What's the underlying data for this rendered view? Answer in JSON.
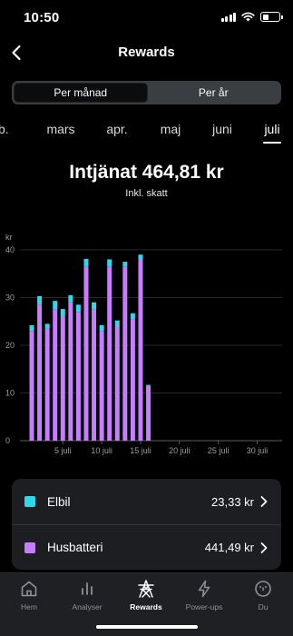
{
  "status_bar": {
    "time": "10:50"
  },
  "header": {
    "title": "Rewards"
  },
  "segment": {
    "month_label": "Per månad",
    "year_label": "Per år"
  },
  "months": {
    "items": [
      "feb.",
      "mars",
      "apr.",
      "maj",
      "juni",
      "juli"
    ],
    "active": "juli"
  },
  "summary": {
    "earned": "Intjänat 464,81 kr",
    "note": "Inkl. skatt"
  },
  "chart_data": {
    "type": "bar",
    "stacked": true,
    "ylabel": "kr",
    "ylim": [
      0,
      40
    ],
    "yticks": [
      0,
      10,
      20,
      30,
      40
    ],
    "x": [
      1,
      2,
      3,
      4,
      5,
      6,
      7,
      8,
      9,
      10,
      11,
      12,
      13,
      14,
      15,
      16,
      17,
      18,
      19,
      20,
      21,
      22,
      23,
      24,
      25,
      26,
      27,
      28,
      29,
      30,
      31
    ],
    "xticks": [
      5,
      10,
      15,
      20,
      25,
      30
    ],
    "xtick_labels": [
      "5 juli",
      "10 juli",
      "15 juli",
      "20 juli",
      "25 juli",
      "30 juli"
    ],
    "series": [
      {
        "name": "Husbatteri",
        "color": "#c77dff",
        "values": [
          23,
          28.5,
          23.5,
          27.5,
          26,
          29,
          27,
          36.5,
          27.5,
          23,
          36.5,
          24,
          36.5,
          25.5,
          38,
          11.5
        ]
      },
      {
        "name": "Elbil",
        "color": "#2fd7e8",
        "values": [
          1.2,
          1.8,
          1.0,
          1.8,
          1.6,
          1.5,
          1.5,
          1.6,
          1.5,
          1.2,
          1.5,
          1.2,
          1.0,
          1.2,
          1.0,
          0.2
        ]
      }
    ],
    "grid": true
  },
  "breakdown": [
    {
      "label": "Elbil",
      "value": "23,33 kr",
      "color": "#2fd7e8"
    },
    {
      "label": "Husbatteri",
      "value": "441,49 kr",
      "color": "#c77dff"
    }
  ],
  "tabs": [
    {
      "label": "Hem",
      "icon": "home-icon"
    },
    {
      "label": "Analyser",
      "icon": "analytics-icon"
    },
    {
      "label": "Rewards",
      "icon": "rewards-tower-icon",
      "active": true
    },
    {
      "label": "Power-ups",
      "icon": "lightning-icon"
    },
    {
      "label": "Du",
      "icon": "profile-icon"
    }
  ]
}
